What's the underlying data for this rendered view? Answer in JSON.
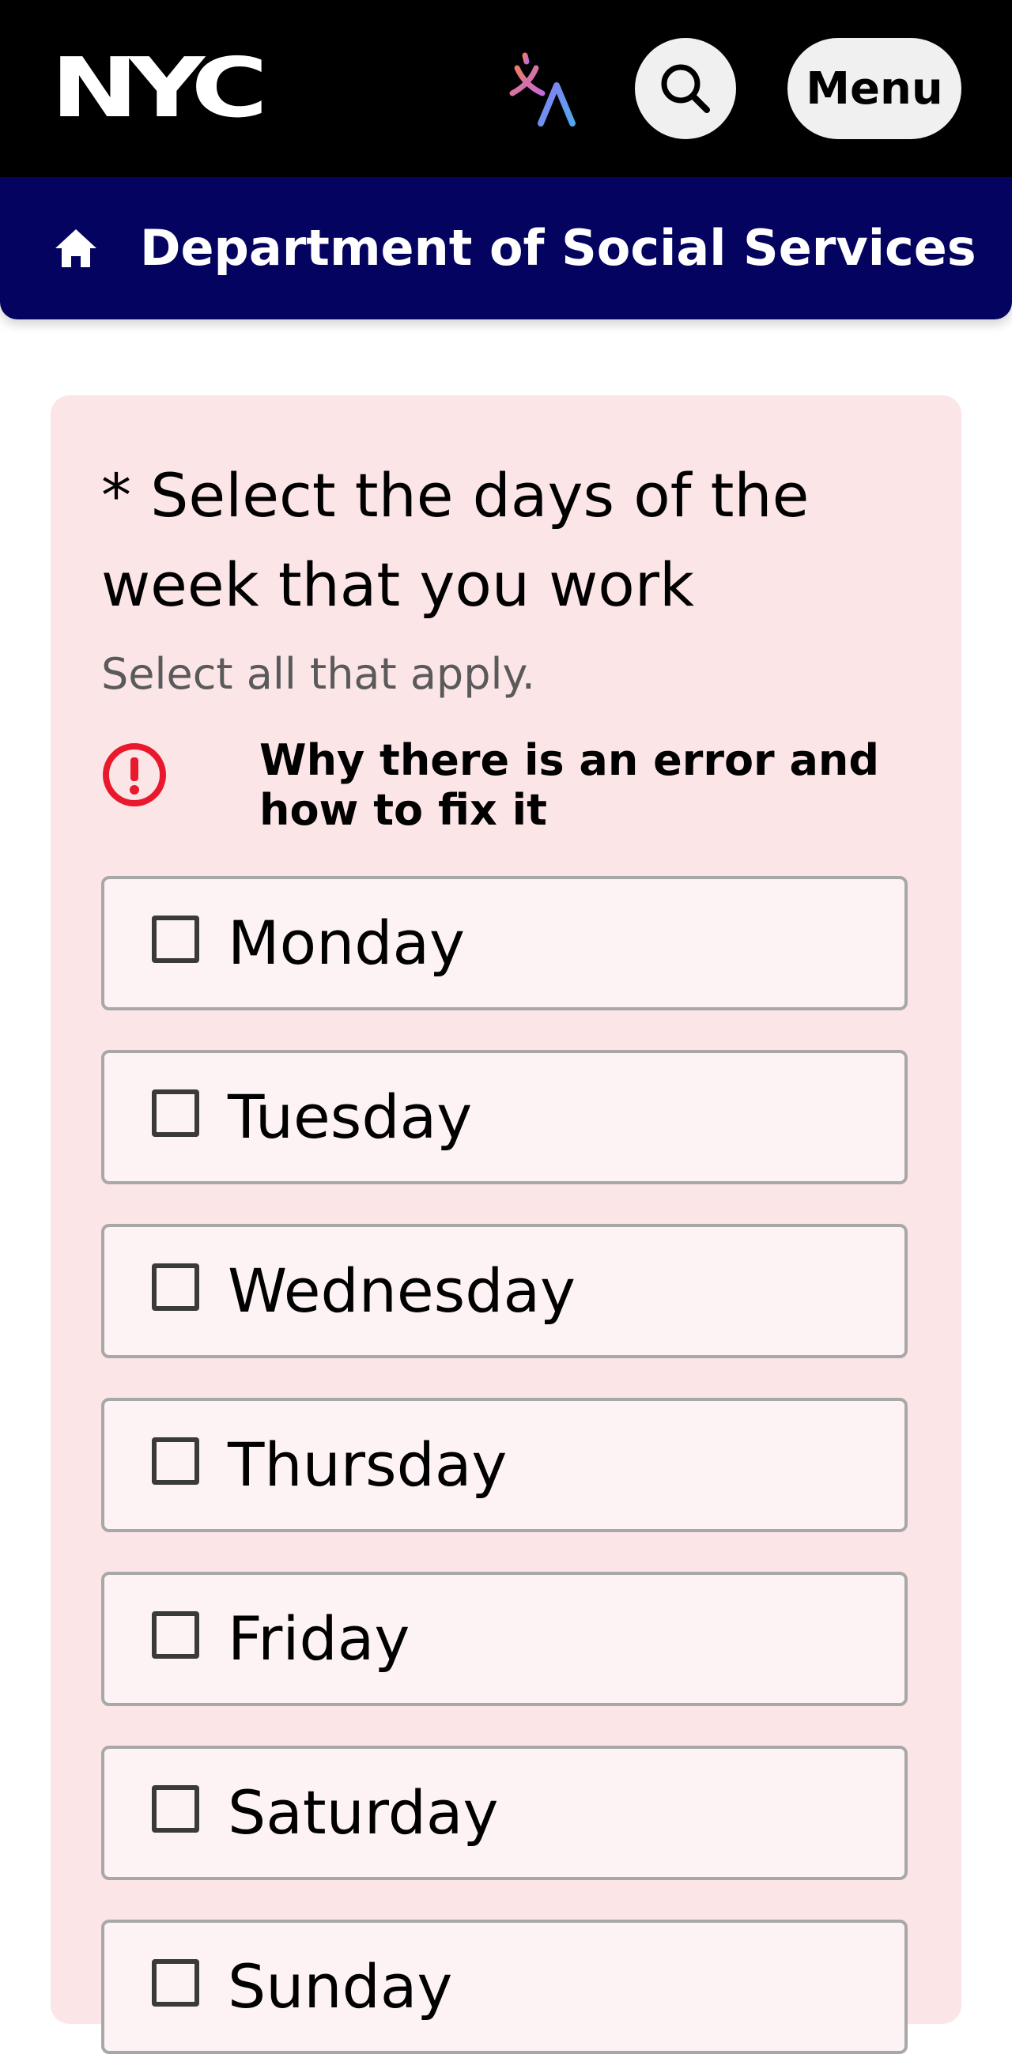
{
  "header": {
    "logo_text": "NYC",
    "translate_icon": "translate-icon",
    "search_icon": "search-icon",
    "menu_label": "Menu"
  },
  "department": {
    "home_icon": "home-icon",
    "title": "Department of Social Services"
  },
  "form": {
    "question": "* Select the days of the week that you work",
    "hint": "Select all that apply.",
    "error_icon": "error-icon",
    "error_message": "Why there is an error and how to fix it",
    "options": [
      {
        "label": "Monday",
        "checked": false
      },
      {
        "label": "Tuesday",
        "checked": false
      },
      {
        "label": "Wednesday",
        "checked": false
      },
      {
        "label": "Thursday",
        "checked": false
      },
      {
        "label": "Friday",
        "checked": false
      },
      {
        "label": "Saturday",
        "checked": false
      },
      {
        "label": "Sunday",
        "checked": false
      }
    ]
  },
  "colors": {
    "header_bg": "#000000",
    "department_bg": "#04035f",
    "card_bg": "#fce5e7",
    "error_red": "#e8192c"
  }
}
